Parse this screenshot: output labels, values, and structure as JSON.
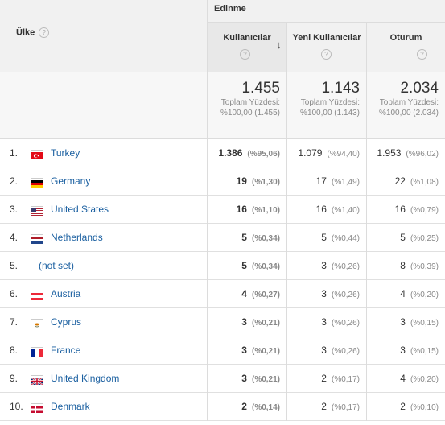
{
  "header": {
    "dimension_label": "Ülke",
    "group_label": "Edinme",
    "metrics": [
      {
        "label": "Kullanıcılar",
        "sorted": true
      },
      {
        "label": "Yeni Kullanıcılar",
        "sorted": false
      },
      {
        "label": "Oturum",
        "sorted": false
      }
    ],
    "help_glyph": "?",
    "sort_glyph": "↓"
  },
  "totals": [
    {
      "value": "1.455",
      "line1": "Toplam Yüzdesi:",
      "line2": "%100,00 (1.455)"
    },
    {
      "value": "1.143",
      "line1": "Toplam Yüzdesi:",
      "line2": "%100,00 (1.143)"
    },
    {
      "value": "2.034",
      "line1": "Toplam Yüzdesi:",
      "line2": "%100,00 (2.034)"
    }
  ],
  "rows": [
    {
      "index": "1.",
      "country": "Turkey",
      "flag": "tr",
      "cells": [
        [
          "1.386",
          "(%95,06)"
        ],
        [
          "1.079",
          "(%94,40)"
        ],
        [
          "1.953",
          "(%96,02)"
        ]
      ]
    },
    {
      "index": "2.",
      "country": "Germany",
      "flag": "de",
      "cells": [
        [
          "19",
          "(%1,30)"
        ],
        [
          "17",
          "(%1,49)"
        ],
        [
          "22",
          "(%1,08)"
        ]
      ]
    },
    {
      "index": "3.",
      "country": "United States",
      "flag": "us",
      "cells": [
        [
          "16",
          "(%1,10)"
        ],
        [
          "16",
          "(%1,40)"
        ],
        [
          "16",
          "(%0,79)"
        ]
      ]
    },
    {
      "index": "4.",
      "country": "Netherlands",
      "flag": "nl",
      "cells": [
        [
          "5",
          "(%0,34)"
        ],
        [
          "5",
          "(%0,44)"
        ],
        [
          "5",
          "(%0,25)"
        ]
      ]
    },
    {
      "index": "5.",
      "country": "(not set)",
      "flag": "",
      "cells": [
        [
          "5",
          "(%0,34)"
        ],
        [
          "3",
          "(%0,26)"
        ],
        [
          "8",
          "(%0,39)"
        ]
      ]
    },
    {
      "index": "6.",
      "country": "Austria",
      "flag": "at",
      "cells": [
        [
          "4",
          "(%0,27)"
        ],
        [
          "3",
          "(%0,26)"
        ],
        [
          "4",
          "(%0,20)"
        ]
      ]
    },
    {
      "index": "7.",
      "country": "Cyprus",
      "flag": "cy",
      "cells": [
        [
          "3",
          "(%0,21)"
        ],
        [
          "3",
          "(%0,26)"
        ],
        [
          "3",
          "(%0,15)"
        ]
      ]
    },
    {
      "index": "8.",
      "country": "France",
      "flag": "fr",
      "cells": [
        [
          "3",
          "(%0,21)"
        ],
        [
          "3",
          "(%0,26)"
        ],
        [
          "3",
          "(%0,15)"
        ]
      ]
    },
    {
      "index": "9.",
      "country": "United Kingdom",
      "flag": "gb",
      "cells": [
        [
          "3",
          "(%0,21)"
        ],
        [
          "2",
          "(%0,17)"
        ],
        [
          "4",
          "(%0,20)"
        ]
      ]
    },
    {
      "index": "10.",
      "country": "Denmark",
      "flag": "dk",
      "cells": [
        [
          "2",
          "(%0,14)"
        ],
        [
          "2",
          "(%0,17)"
        ],
        [
          "2",
          "(%0,10)"
        ]
      ]
    }
  ],
  "colors": {
    "link": "#1a5fa0",
    "header_bg": "#f1f1f1",
    "sorted_bg": "#e8e8e8"
  }
}
